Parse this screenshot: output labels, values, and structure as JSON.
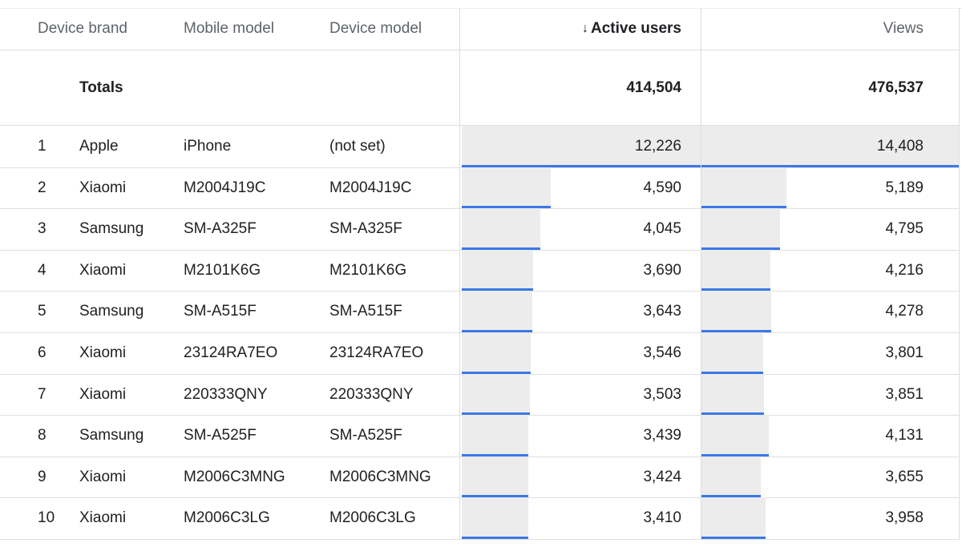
{
  "header": {
    "device_brand": "Device brand",
    "mobile_model": "Mobile model",
    "device_model": "Device model",
    "active_users": "Active users",
    "views": "Views"
  },
  "totals": {
    "label": "Totals",
    "active_users": "414,504",
    "views": "476,537"
  },
  "rows": [
    {
      "index": "1",
      "brand": "Apple",
      "mobile_model": "iPhone",
      "device_model": "(not set)",
      "active_users": "12,226",
      "views": "14,408",
      "users_value": 12226,
      "views_value": 14408
    },
    {
      "index": "2",
      "brand": "Xiaomi",
      "mobile_model": "M2004J19C",
      "device_model": "M2004J19C",
      "active_users": "4,590",
      "views": "5,189",
      "users_value": 4590,
      "views_value": 5189
    },
    {
      "index": "3",
      "brand": "Samsung",
      "mobile_model": "SM-A325F",
      "device_model": "SM-A325F",
      "active_users": "4,045",
      "views": "4,795",
      "users_value": 4045,
      "views_value": 4795
    },
    {
      "index": "4",
      "brand": "Xiaomi",
      "mobile_model": "M2101K6G",
      "device_model": "M2101K6G",
      "active_users": "3,690",
      "views": "4,216",
      "users_value": 3690,
      "views_value": 4216
    },
    {
      "index": "5",
      "brand": "Samsung",
      "mobile_model": "SM-A515F",
      "device_model": "SM-A515F",
      "active_users": "3,643",
      "views": "4,278",
      "users_value": 3643,
      "views_value": 4278
    },
    {
      "index": "6",
      "brand": "Xiaomi",
      "mobile_model": "23124RA7EO",
      "device_model": "23124RA7EO",
      "active_users": "3,546",
      "views": "3,801",
      "users_value": 3546,
      "views_value": 3801
    },
    {
      "index": "7",
      "brand": "Xiaomi",
      "mobile_model": "220333QNY",
      "device_model": "220333QNY",
      "active_users": "3,503",
      "views": "3,851",
      "users_value": 3503,
      "views_value": 3851
    },
    {
      "index": "8",
      "brand": "Samsung",
      "mobile_model": "SM-A525F",
      "device_model": "SM-A525F",
      "active_users": "3,439",
      "views": "4,131",
      "users_value": 3439,
      "views_value": 4131
    },
    {
      "index": "9",
      "brand": "Xiaomi",
      "mobile_model": "M2006C3MNG",
      "device_model": "M2006C3MNG",
      "active_users": "3,424",
      "views": "3,655",
      "users_value": 3424,
      "views_value": 3655
    },
    {
      "index": "10",
      "brand": "Xiaomi",
      "mobile_model": "M2006C3LG",
      "device_model": "M2006C3LG",
      "active_users": "3,410",
      "views": "3,958",
      "users_value": 3410,
      "views_value": 3958
    }
  ],
  "colors": {
    "bar_fill": "#ececec",
    "bar_line": "#3b78e7"
  },
  "icons": {
    "sort": "sort-descending-arrow-icon"
  }
}
